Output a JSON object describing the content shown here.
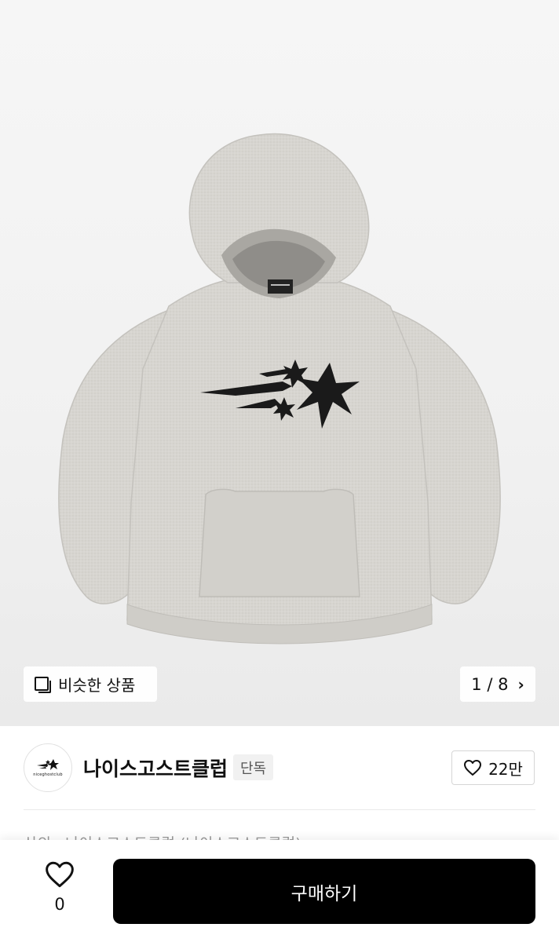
{
  "product": {
    "similar_label": "비슷한 상품",
    "pager_text": "1 / 8",
    "image_index": 1,
    "image_total": 8
  },
  "brand": {
    "name": "나이스고스트클럽",
    "badge": "단독",
    "logo_text": "niceghostclub",
    "likes": "22만"
  },
  "description_preview": "상의 · 나이스고스트클럽 (나이스고스트클럽)",
  "bottom_bar": {
    "wish_count": "0",
    "buy_label": "구매하기"
  },
  "colors": {
    "buy_button": "#000000",
    "hoodie": "#d6d4cf",
    "graphic": "#1a1a1a"
  },
  "icons": {
    "similar": "similar-products-icon",
    "pager": "chevron-right-icon",
    "like": "heart-outline-icon",
    "wish": "heart-outline-icon"
  }
}
